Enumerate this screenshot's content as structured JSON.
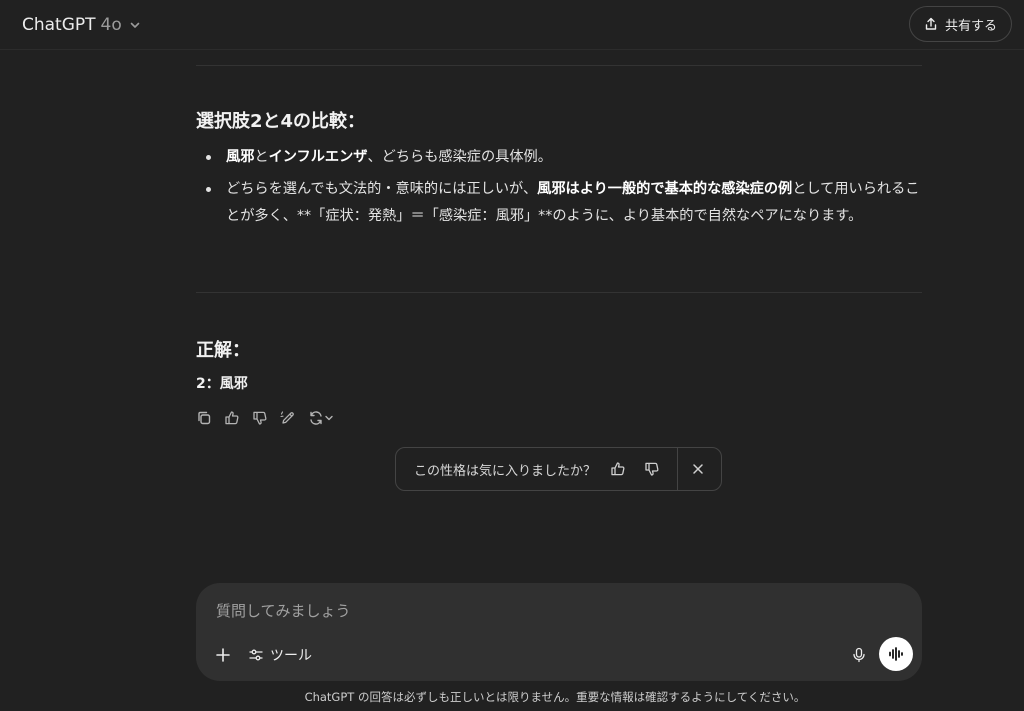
{
  "header": {
    "model_name": "ChatGPT",
    "model_version": "4o",
    "share_label": "共有する"
  },
  "message": {
    "section_comparison_title": "選択肢2と4の比較：",
    "bullet1": {
      "bold1": "風邪",
      "text1": "と",
      "bold2": "インフルエンザ",
      "text2": "、どちらも感染症の具体例。"
    },
    "bullet2": {
      "text1": "どちらを選んでも文法的・意味的には正しいが、",
      "bold1": "風邪はより一般的で基本的な感染症の例",
      "text2": "として用いられることが多く、**「症状：発熱」＝「感染症：風邪」**のように、より基本的で自然なペアになります。"
    },
    "section_answer_title": "正解：",
    "answer": "2：風邪"
  },
  "feedback": {
    "question": "この性格は気に入りましたか？"
  },
  "composer": {
    "placeholder": "質問してみましょう",
    "tools_label": "ツール"
  },
  "footer": {
    "disclaimer": "ChatGPT の回答は必ずしも正しいとは限りません。重要な情報は確認するようにしてください。"
  },
  "icons": {
    "chevron": "chevron-down-icon",
    "share": "share-icon",
    "copy": "copy-icon",
    "thumbs_up": "thumbs-up-icon",
    "thumbs_down": "thumbs-down-icon",
    "edit": "edit-icon",
    "regenerate": "regenerate-icon",
    "close": "close-icon",
    "plus": "plus-icon",
    "tools": "sliders-icon",
    "mic": "mic-icon",
    "voice": "voice-mode-icon"
  }
}
